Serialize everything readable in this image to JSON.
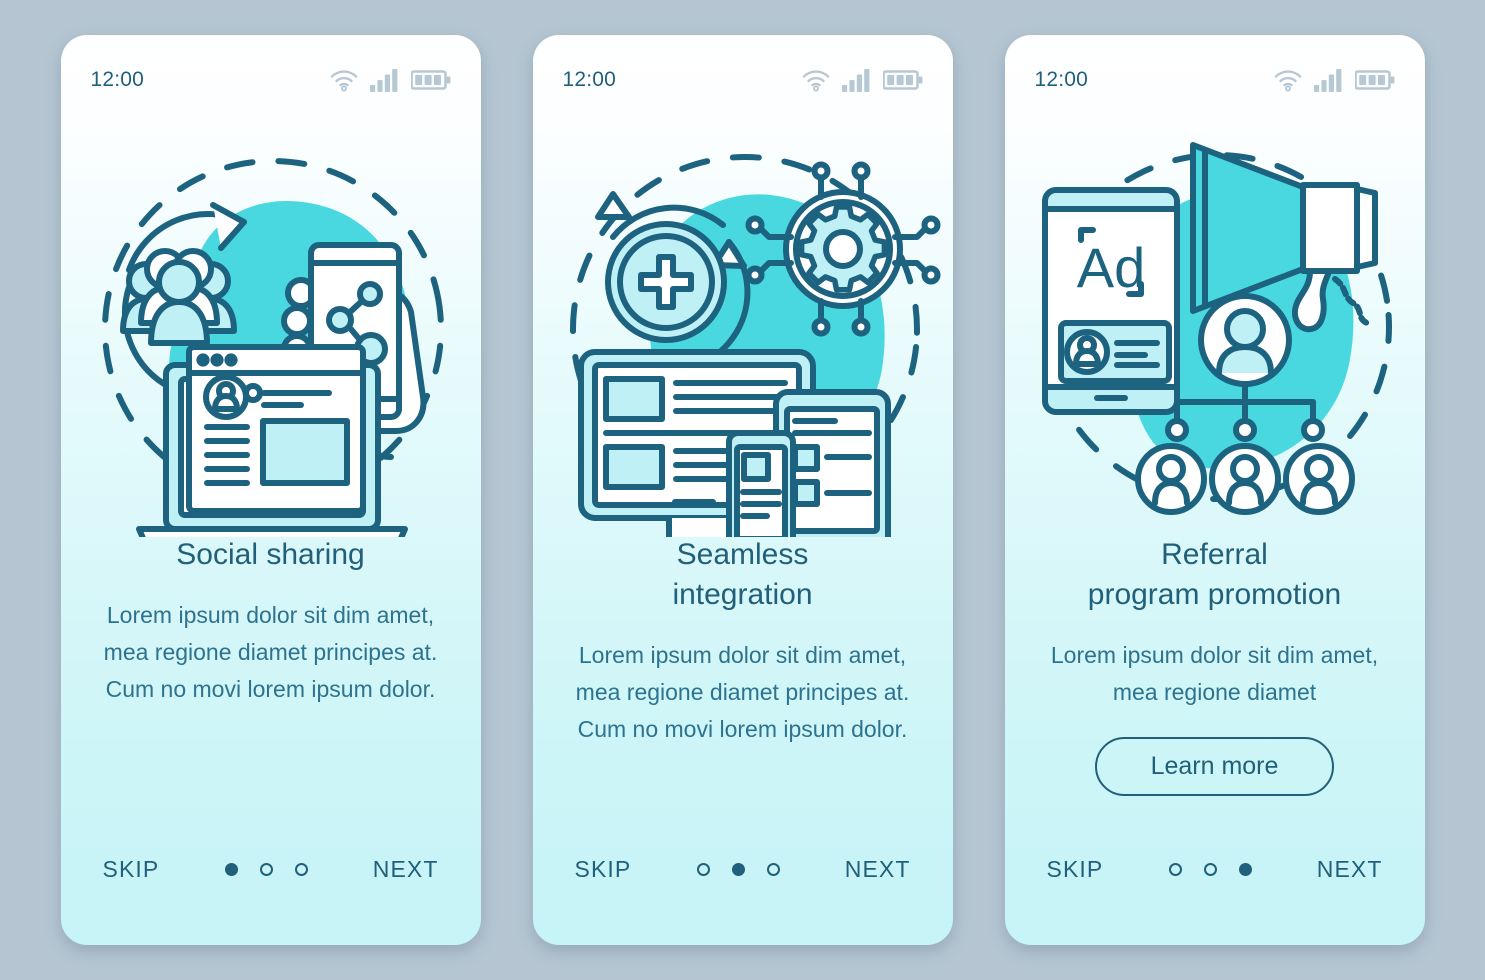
{
  "palette": {
    "page_background": "#b5c6d2",
    "line": "#21607a",
    "blob": "#4ad8e0",
    "fill_light": "#bff0f5",
    "card_top": "#ffffff",
    "card_bottom": "#c6f4f7",
    "status_icon": "#b7c8d5",
    "text": "#21607a"
  },
  "screens": [
    {
      "status": {
        "time": "12:00",
        "icons": [
          "wifi-icon",
          "signal-icon",
          "battery-icon"
        ]
      },
      "illustration": "social-sharing-illustration",
      "title": "Social sharing",
      "body": "Lorem ipsum dolor sit dim amet, mea regione diamet principes at. Cum no movi lorem ipsum dolor.",
      "cta": null,
      "nav": {
        "skip_label": "SKIP",
        "next_label": "NEXT",
        "dots": 3,
        "active_dot": 0
      }
    },
    {
      "status": {
        "time": "12:00",
        "icons": [
          "wifi-icon",
          "signal-icon",
          "battery-icon"
        ]
      },
      "illustration": "seamless-integration-illustration",
      "title": "Seamless\nintegration",
      "body": "Lorem ipsum dolor sit dim amet, mea regione diamet principes at. Cum no movi lorem ipsum dolor.",
      "cta": null,
      "nav": {
        "skip_label": "SKIP",
        "next_label": "NEXT",
        "dots": 3,
        "active_dot": 1
      }
    },
    {
      "status": {
        "time": "12:00",
        "icons": [
          "wifi-icon",
          "signal-icon",
          "battery-icon"
        ]
      },
      "illustration": "referral-program-illustration",
      "title": "Referral\nprogram promotion",
      "body": "Lorem ipsum dolor sit dim amet, mea regione diamet",
      "cta": "Learn more",
      "nav": {
        "skip_label": "SKIP",
        "next_label": "NEXT",
        "dots": 3,
        "active_dot": 2
      }
    }
  ]
}
